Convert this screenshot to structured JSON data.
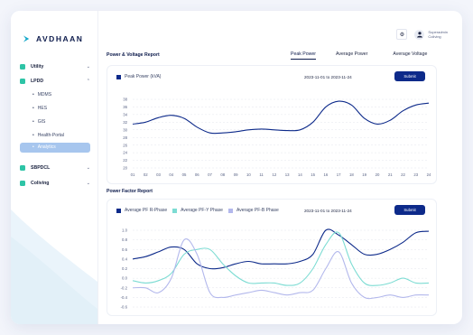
{
  "brand": {
    "name": "AVDHAAN"
  },
  "user": {
    "name": "Superadmin",
    "org": "Coliving"
  },
  "sidebar": {
    "items": [
      {
        "label": "Utility",
        "color": "#2ec4a6"
      },
      {
        "label": "LPDD",
        "color": "#2ec4a6"
      },
      {
        "label": "SBPDCL",
        "color": "#2ec4a6"
      },
      {
        "label": "Coliving",
        "color": "#2ec4a6"
      }
    ],
    "subitems": [
      "MDMS",
      "HES",
      "GIS",
      "Health-Portal",
      "Analytics"
    ]
  },
  "power_report": {
    "title": "Power & Voltage Report",
    "tabs": [
      "Peak Power",
      "Average Power",
      "Average Voltage"
    ],
    "legend": "Peak Power (kVA)",
    "date_range": "2023-11-01 to 2023-11-24",
    "submit": "Submit"
  },
  "pf_report": {
    "title": "Power Factor Report",
    "legend": [
      "Average PF R-Phase",
      "Average PF-Y Phase",
      "Average PF-B Phase"
    ],
    "date_range": "2023-11-01 to 2023-11-24",
    "submit": "Submit"
  },
  "colors": {
    "navy": "#0d2a8a",
    "teal": "#7ddcd3",
    "lavender": "#b3b8ec",
    "accent": "#2ec4a6"
  },
  "chart_data": [
    {
      "type": "line",
      "title": "",
      "x": [
        "01",
        "02",
        "03",
        "04",
        "05",
        "06",
        "07",
        "08",
        "09",
        "10",
        "11",
        "12",
        "13",
        "14",
        "15",
        "16",
        "17",
        "18",
        "19",
        "20",
        "21",
        "22",
        "23",
        "24"
      ],
      "series": [
        {
          "name": "Peak Power (kVA)",
          "values": [
            31.5,
            32,
            33.2,
            33.8,
            33,
            30.7,
            29.2,
            29.2,
            29.5,
            30,
            30.2,
            30,
            29.8,
            30,
            32,
            36,
            37.5,
            36.5,
            33,
            31.5,
            32.5,
            35,
            36.5,
            37
          ]
        }
      ],
      "ylim": [
        20,
        38
      ],
      "yticks": [
        20,
        22,
        24,
        26,
        28,
        30,
        32,
        34,
        36,
        38
      ]
    },
    {
      "type": "line",
      "title": "",
      "x": [
        "01",
        "02",
        "03",
        "04",
        "05",
        "06",
        "07",
        "08",
        "09",
        "10",
        "11",
        "12",
        "13",
        "14",
        "15",
        "16",
        "17",
        "18",
        "19",
        "20",
        "21",
        "22",
        "23",
        "24"
      ],
      "series": [
        {
          "name": "Average PF R-Phase",
          "values": [
            0.4,
            0.45,
            0.55,
            0.65,
            0.6,
            0.3,
            0.2,
            0.22,
            0.3,
            0.35,
            0.3,
            0.3,
            0.3,
            0.35,
            0.5,
            1.0,
            0.9,
            0.7,
            0.5,
            0.5,
            0.6,
            0.75,
            0.95,
            0.98
          ]
        },
        {
          "name": "Average PF-Y Phase",
          "values": [
            -0.05,
            -0.1,
            -0.05,
            0.1,
            0.5,
            0.6,
            0.6,
            0.3,
            0.05,
            -0.1,
            -0.1,
            -0.1,
            -0.15,
            -0.1,
            0.2,
            0.7,
            0.95,
            0.3,
            -0.1,
            -0.15,
            -0.1,
            0.0,
            -0.1,
            -0.1
          ]
        },
        {
          "name": "Average PF-B Phase",
          "values": [
            -0.2,
            -0.2,
            -0.3,
            0.0,
            0.8,
            0.5,
            -0.3,
            -0.4,
            -0.35,
            -0.3,
            -0.25,
            -0.3,
            -0.35,
            -0.3,
            -0.25,
            0.2,
            0.55,
            -0.1,
            -0.4,
            -0.4,
            -0.35,
            -0.4,
            -0.35,
            -0.35
          ]
        }
      ],
      "ylim": [
        -0.6,
        1.0
      ],
      "yticks": [
        -0.6,
        -0.4,
        -0.2,
        0.0,
        0.2,
        0.4,
        0.6,
        0.8,
        1.0
      ]
    }
  ]
}
